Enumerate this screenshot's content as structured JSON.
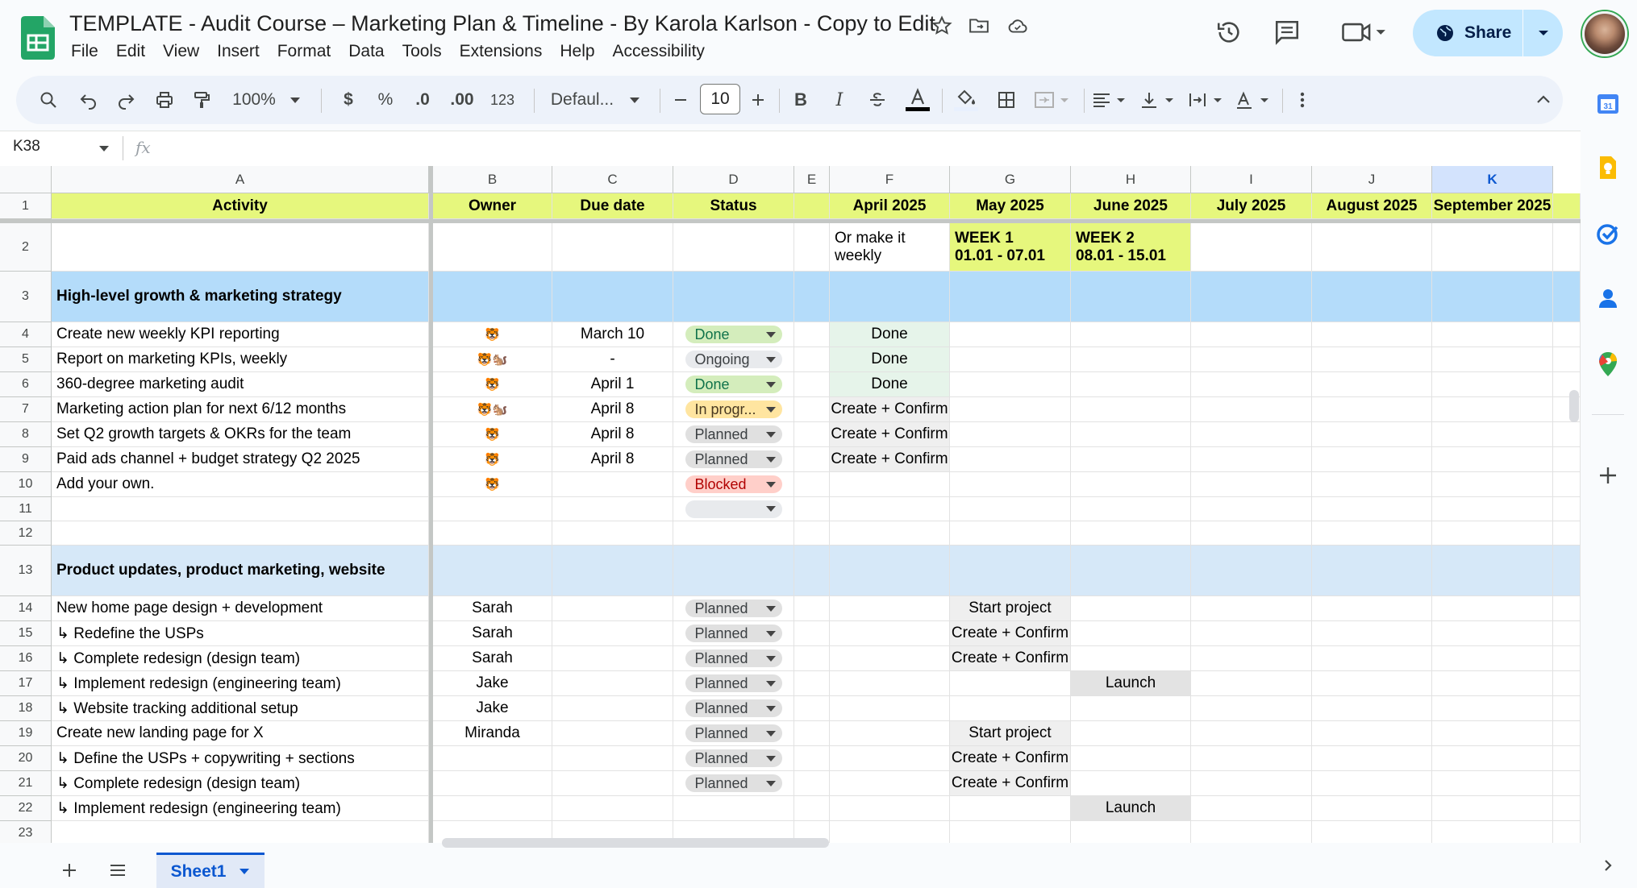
{
  "app": {
    "title": "TEMPLATE - Audit Course – Marketing Plan & Timeline - By Karola Karlson - Copy to Edit",
    "menu": [
      "File",
      "Edit",
      "View",
      "Insert",
      "Format",
      "Data",
      "Tools",
      "Extensions",
      "Help",
      "Accessibility"
    ],
    "share_label": "Share"
  },
  "toolbar": {
    "zoom": "100%",
    "currency": "$",
    "percent": "%",
    "dec_decrease": ".0",
    "dec_increase": ".00",
    "number_format": "123",
    "font": "Defaul...",
    "font_size": "10",
    "bold": "B",
    "italic": "I"
  },
  "formula_bar": {
    "name_box": "K38",
    "fx": "fx",
    "formula": ""
  },
  "grid": {
    "columns": [
      "A",
      "B",
      "C",
      "D",
      "E",
      "F",
      "G",
      "H",
      "I",
      "J",
      "K"
    ],
    "selected_column": "K",
    "rows": [
      "1",
      "2",
      "3",
      "4",
      "5",
      "6",
      "7",
      "8",
      "9",
      "10",
      "11",
      "12",
      "13",
      "14",
      "15",
      "16",
      "17",
      "18",
      "19",
      "20",
      "21",
      "22",
      "23"
    ],
    "header": {
      "activity": "Activity",
      "owner": "Owner",
      "due": "Due date",
      "status": "Status",
      "months": [
        "April 2025",
        "May 2025",
        "June 2025",
        "July 2025",
        "August 2025",
        "September 2025"
      ]
    },
    "row2": {
      "f": "Or make it weekly",
      "g": "WEEK 1\n01.01 - 07.01",
      "h": "WEEK 2\n08.01 - 15.01"
    },
    "section1": "High-level growth & marketing strategy",
    "section2": "Product updates, product marketing, website",
    "tasks1": [
      {
        "activity": "Create new weekly KPI reporting",
        "owner": "🐯",
        "due": "March 10",
        "status": "Done",
        "f": "Done"
      },
      {
        "activity": "Report on marketing KPIs, weekly",
        "owner": "🐯🐿️",
        "due": "-",
        "status": "Ongoing",
        "f": "Done"
      },
      {
        "activity": "360-degree marketing audit",
        "owner": "🐯",
        "due": "April 1",
        "status": "Done",
        "f": "Done"
      },
      {
        "activity": "Marketing action plan for next 6/12 months",
        "owner": "🐯🐿️",
        "due": "April 8",
        "status": "In progr...",
        "f": "Create + Confirm"
      },
      {
        "activity": "Set Q2 growth targets & OKRs for the team",
        "owner": "🐯",
        "due": "April 8",
        "status": "Planned",
        "f": "Create + Confirm"
      },
      {
        "activity": "Paid ads channel + budget strategy Q2 2025",
        "owner": "🐯",
        "due": "April 8",
        "status": "Planned",
        "f": "Create + Confirm"
      },
      {
        "activity": "Add your own.",
        "owner": "🐯",
        "due": "",
        "status": "Blocked",
        "f": ""
      },
      {
        "activity": "",
        "owner": "",
        "due": "",
        "status": "",
        "f": ""
      }
    ],
    "tasks2": [
      {
        "activity": "New home page design + development",
        "owner": "Sarah",
        "status": "Planned",
        "g": "Start project",
        "h": ""
      },
      {
        "activity": "↳ Redefine the USPs",
        "owner": "Sarah",
        "status": "Planned",
        "g": "Create + Confirm",
        "h": ""
      },
      {
        "activity": "↳ Complete redesign (design team)",
        "owner": "Sarah",
        "status": "Planned",
        "g": "Create + Confirm",
        "h": ""
      },
      {
        "activity": "↳ Implement redesign (engineering team)",
        "owner": "Jake",
        "status": "Planned",
        "g": "",
        "h": "Launch"
      },
      {
        "activity": "↳ Website tracking additional setup",
        "owner": "Jake",
        "status": "Planned",
        "g": "",
        "h": ""
      },
      {
        "activity": "Create new landing page for X",
        "owner": "Miranda",
        "status": "Planned",
        "g": "Start project",
        "h": ""
      },
      {
        "activity": "↳ Define the USPs + copywriting + sections",
        "owner": "",
        "status": "Planned",
        "g": "Create + Confirm",
        "h": ""
      },
      {
        "activity": "↳ Complete redesign (design team)",
        "owner": "",
        "status": "Planned",
        "g": "Create + Confirm",
        "h": ""
      },
      {
        "activity": "↳ Implement redesign (engineering team)",
        "owner": "",
        "status": "",
        "g": "",
        "h": "Launch"
      }
    ]
  },
  "sheet_tabs": [
    "Sheet1"
  ],
  "colors": {
    "header_row": "#e6f77d",
    "section1": "#b4dcfa",
    "section2": "#d6e8f8",
    "accent": "#0b57d0"
  }
}
